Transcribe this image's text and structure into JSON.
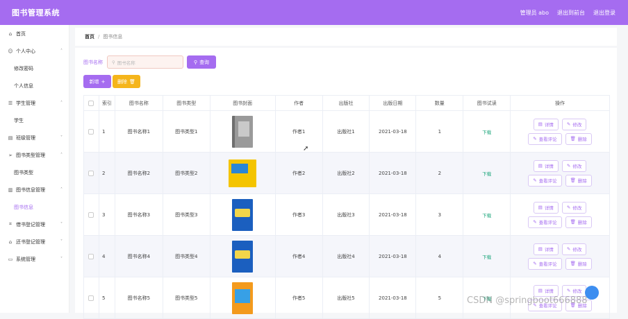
{
  "app": {
    "title": "图书管理系统"
  },
  "topbar": {
    "user": "管理员 abo",
    "back_to_front": "退出到前台",
    "logout": "退出登录"
  },
  "sidebar": {
    "items": [
      {
        "label": "首页",
        "icon": "home-icon",
        "chevron": false
      },
      {
        "label": "个人中心",
        "icon": "user-icon",
        "chevron": "up"
      },
      {
        "label": "修改密码",
        "sub": true
      },
      {
        "label": "个人信息",
        "sub": true
      },
      {
        "label": "学生管理",
        "icon": "list-icon",
        "chevron": "up"
      },
      {
        "label": "学生",
        "sub": true
      },
      {
        "label": "班级管理",
        "icon": "chart-icon",
        "chevron": "down"
      },
      {
        "label": "图书类型管理",
        "icon": "send-icon",
        "chevron": "up"
      },
      {
        "label": "图书类型",
        "sub": true
      },
      {
        "label": "图书信息管理",
        "icon": "bar-icon",
        "chevron": "up"
      },
      {
        "label": "图书信息",
        "sub": true,
        "active": true
      },
      {
        "label": "借书登记管理",
        "icon": "crop-icon",
        "chevron": "down"
      },
      {
        "label": "还书登记管理",
        "icon": "bank-icon",
        "chevron": "down"
      },
      {
        "label": "系统管理",
        "icon": "message-icon",
        "chevron": "down"
      }
    ]
  },
  "breadcrumb": {
    "home": "首页",
    "separator": "/",
    "current": "图书信息"
  },
  "search": {
    "label": "图书名称",
    "placeholder": "图书名称",
    "query_button": "查询"
  },
  "actions": {
    "add": "新增",
    "delete": "删除"
  },
  "table": {
    "headers": [
      "索引",
      "图书名称",
      "图书类型",
      "图书封面",
      "作者",
      "出版社",
      "出版日期",
      "数量",
      "图书试读",
      "操作"
    ],
    "rows": [
      {
        "index": "1",
        "name": "图书名称1",
        "type": "图书类型1",
        "author": "作者1",
        "publisher": "出版社1",
        "date": "2021-03-18",
        "qty": "1",
        "trial": "下载",
        "cover": "b1"
      },
      {
        "index": "2",
        "name": "图书名称2",
        "type": "图书类型2",
        "author": "作者2",
        "publisher": "出版社2",
        "date": "2021-03-18",
        "qty": "2",
        "trial": "下载",
        "cover": "b2"
      },
      {
        "index": "3",
        "name": "图书名称3",
        "type": "图书类型3",
        "author": "作者3",
        "publisher": "出版社3",
        "date": "2021-03-18",
        "qty": "3",
        "trial": "下载",
        "cover": "b3"
      },
      {
        "index": "4",
        "name": "图书名称4",
        "type": "图书类型4",
        "author": "作者4",
        "publisher": "出版社4",
        "date": "2021-03-18",
        "qty": "4",
        "trial": "下载",
        "cover": "b4"
      },
      {
        "index": "5",
        "name": "图书名称5",
        "type": "图书类型5",
        "author": "作者5",
        "publisher": "出版社5",
        "date": "2021-03-18",
        "qty": "5",
        "trial": "下载",
        "cover": "b5"
      }
    ],
    "ops": {
      "detail": "详情",
      "edit": "修改",
      "comments": "查看评论",
      "delete": "删除"
    }
  },
  "watermark": "CSDN @springboot666888",
  "colors": {
    "primary": "#a56cf0",
    "warning": "#f5b51b",
    "link": "#1aa57a"
  }
}
